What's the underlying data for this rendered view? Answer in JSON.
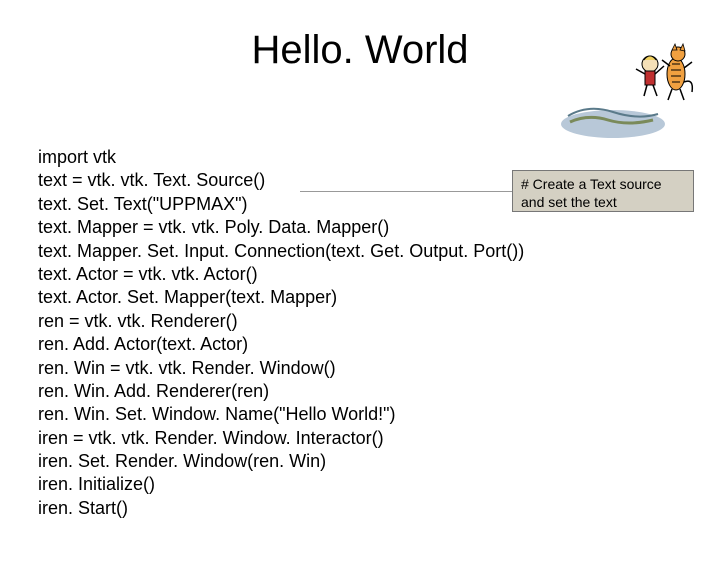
{
  "title": "Hello. World",
  "code_lines": [
    "import vtk",
    "text = vtk. vtk. Text. Source()",
    "text. Set. Text(\"UPPMAX\")",
    "text. Mapper = vtk. vtk. Poly. Data. Mapper()",
    "text. Mapper. Set. Input. Connection(text. Get. Output. Port())",
    "text. Actor = vtk. vtk. Actor()",
    "text. Actor. Set. Mapper(text. Mapper)",
    "ren = vtk. vtk. Renderer()",
    "ren. Add. Actor(text. Actor)",
    "ren. Win = vtk. vtk. Render. Window()",
    "ren. Win. Add. Renderer(ren)",
    "ren. Win. Set. Window. Name(\"Hello World!\")",
    "iren = vtk. vtk. Render. Window. Interactor()",
    "iren. Set. Render. Window(ren. Win)",
    "iren. Initialize()",
    "iren. Start()"
  ],
  "callout": {
    "line1": "# Create a Text source",
    "line2": "and set the text"
  }
}
